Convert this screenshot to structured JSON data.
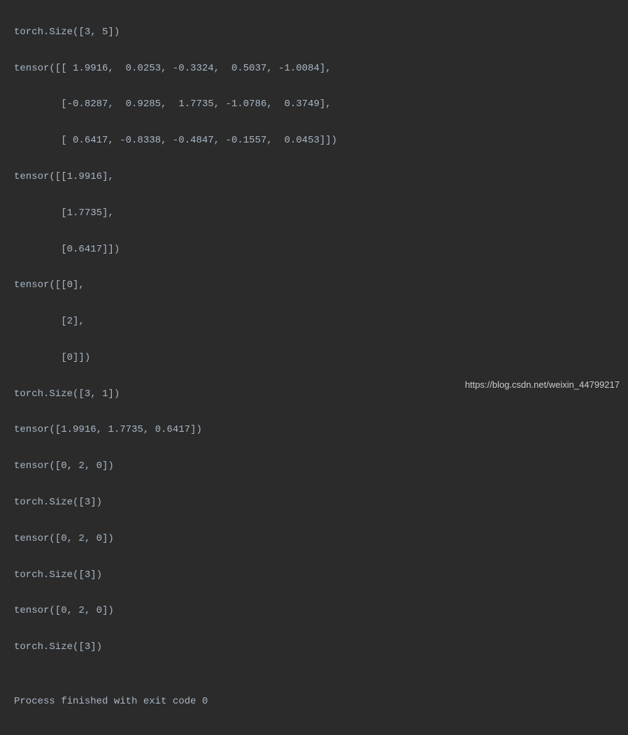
{
  "output": {
    "line1": "torch.Size([3, 5])",
    "line2": "tensor([[ 1.9916,  0.0253, -0.3324,  0.5037, -1.0084],",
    "line3": "        [-0.8287,  0.9285,  1.7735, -1.0786,  0.3749],",
    "line4": "        [ 0.6417, -0.8338, -0.4847, -0.1557,  0.0453]])",
    "line5": "tensor([[1.9916],",
    "line6": "        [1.7735],",
    "line7": "        [0.6417]])",
    "line8": "tensor([[0],",
    "line9": "        [2],",
    "line10": "        [0]])",
    "line11": "torch.Size([3, 1])",
    "line12": "tensor([1.9916, 1.7735, 0.6417])",
    "line13": "tensor([0, 2, 0])",
    "line14": "torch.Size([3])",
    "line15": "tensor([0, 2, 0])",
    "line16": "torch.Size([3])",
    "line17": "tensor([0, 2, 0])",
    "line18": "torch.Size([3])",
    "line19": "",
    "line20": "Process finished with exit code 0"
  },
  "watermark": "https://blog.csdn.net/weixin_44799217"
}
